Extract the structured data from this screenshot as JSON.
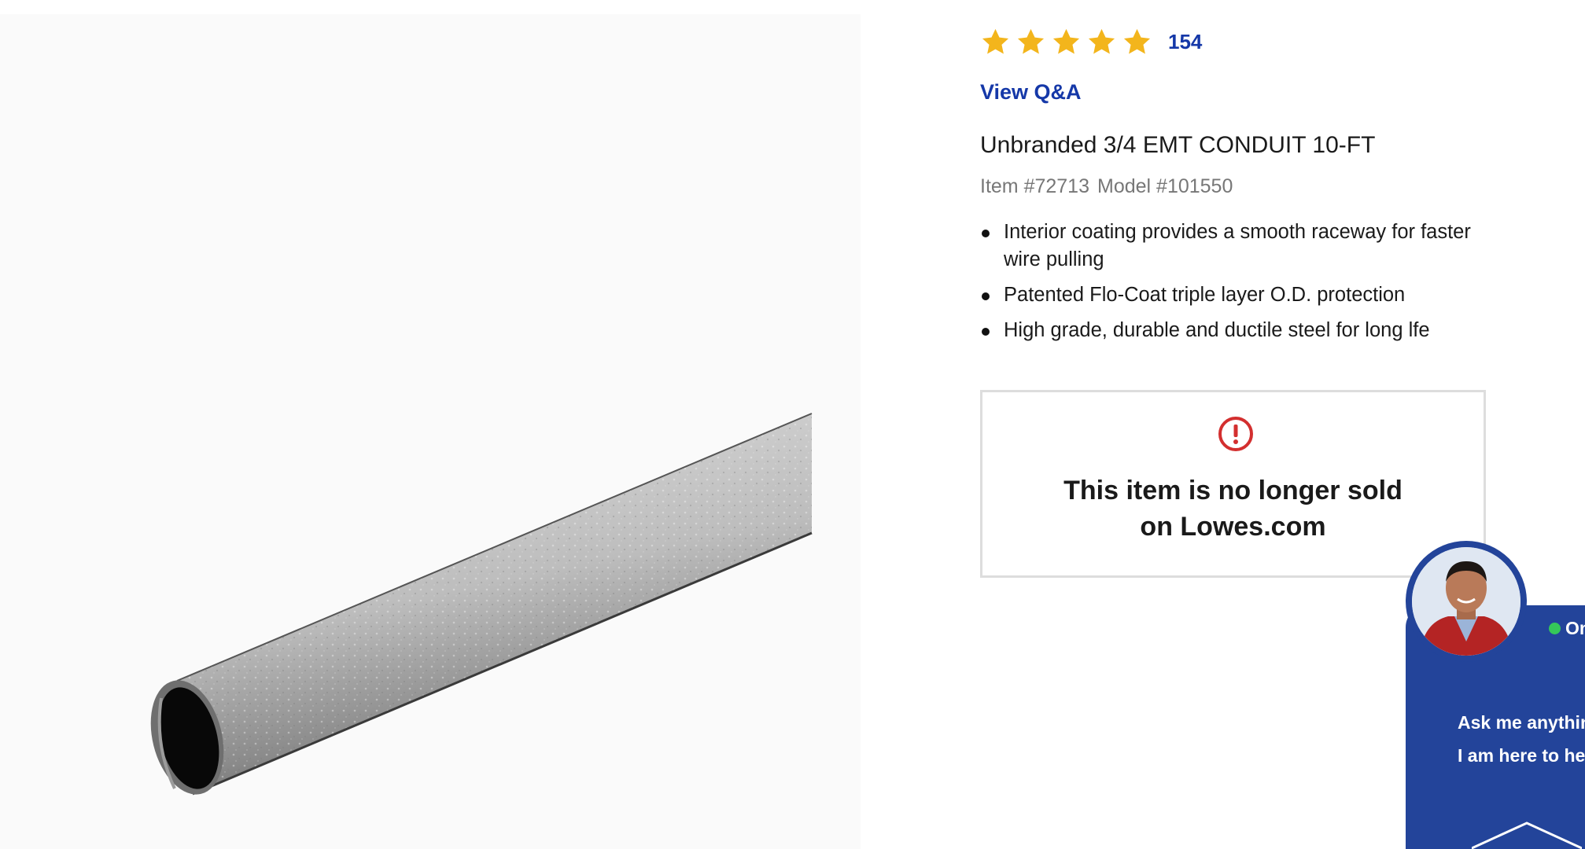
{
  "product": {
    "rating": {
      "stars": 5,
      "review_count": "154"
    },
    "qa_link": "View Q&A",
    "title": "Unbranded 3/4 EMT CONDUIT 10-FT",
    "item_number": "Item #72713",
    "model_number": "Model #101550",
    "features": [
      "Interior coating provides a smooth raceway for faster wire pulling",
      "Patented Flo-Coat triple layer O.D. protection",
      "High grade, durable and ductile steel for long lfe"
    ]
  },
  "notice": {
    "icon": "alert-circle-icon",
    "line1": "This item is no longer sold",
    "line2": "on Lowes.com"
  },
  "chat": {
    "status": "On",
    "message_line1": "Ask me anythin",
    "message_line2": "I am here to he"
  },
  "colors": {
    "star": "#f3b51c",
    "link": "#1538a8",
    "alert": "#d32f2f",
    "chat_bg": "#23449a",
    "online": "#35c759"
  }
}
